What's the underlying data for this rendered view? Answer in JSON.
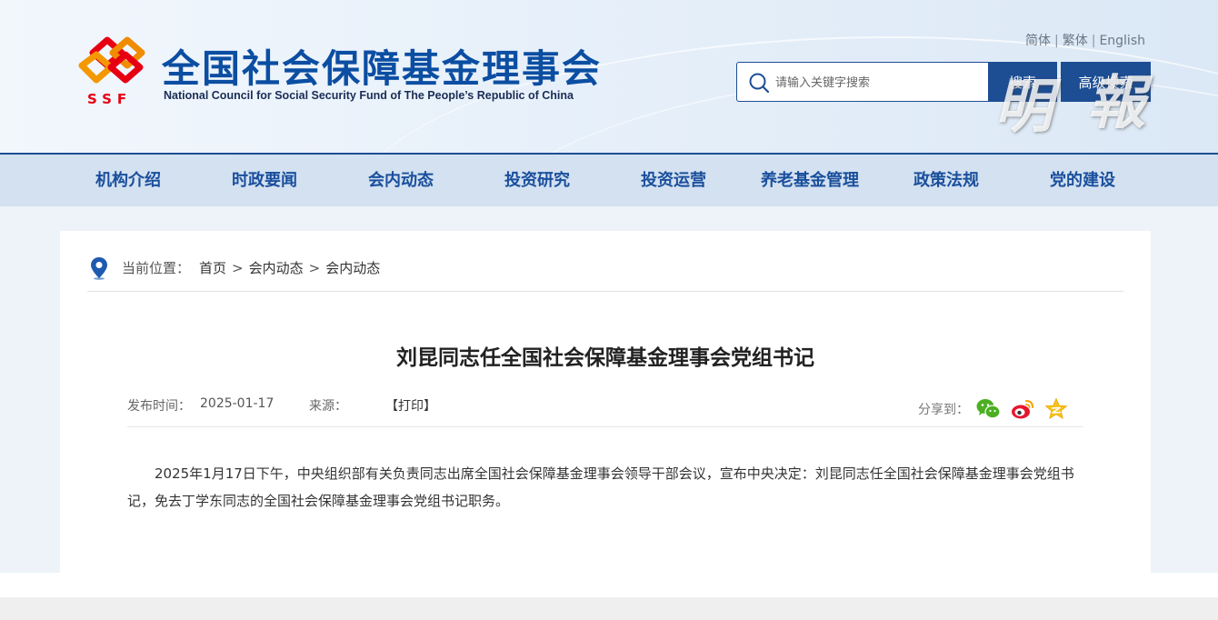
{
  "site": {
    "title_cn": "全国社会保障基金理事会",
    "title_en": "National Council for Social Security Fund of The People’s Republic of China",
    "logo_text": "SSF",
    "brand_red": "#e60012",
    "brand_blue": "#0b4ea2"
  },
  "lang": {
    "simplified": "简体",
    "traditional": "繁体",
    "english": "English",
    "separator": "|"
  },
  "search": {
    "placeholder": "请输入关键字搜索",
    "button": "搜索",
    "advanced_button": "高级搜索"
  },
  "watermark": {
    "char1": "明",
    "char2": "報"
  },
  "nav": {
    "items": [
      "机构介绍",
      "时政要闻",
      "会内动态",
      "投资研究",
      "投资运营",
      "养老基金管理",
      "政策法规",
      "党的建设"
    ]
  },
  "breadcrumb": {
    "label": "当前位置：",
    "items": [
      "首页",
      "会内动态",
      "会内动态"
    ],
    "separator": ">"
  },
  "article": {
    "title": "刘昆同志任全国社会保障基金理事会党组书记",
    "date_label": "发布时间：",
    "date": "2025-01-17",
    "source_label": "来源：",
    "print": "【打印】",
    "share_label": "分享到：",
    "body": "2025年1月17日下午，中央组织部有关负责同志出席全国社会保障基金理事会领导干部会议，宣布中央决定：刘昆同志任全国社会保障基金理事会党组书记，免去丁学东同志的全国社会保障基金理事会党组书记职务。"
  },
  "icons": [
    "location-pin-icon",
    "search-icon",
    "wechat-icon",
    "weibo-icon",
    "qzone-icon"
  ]
}
